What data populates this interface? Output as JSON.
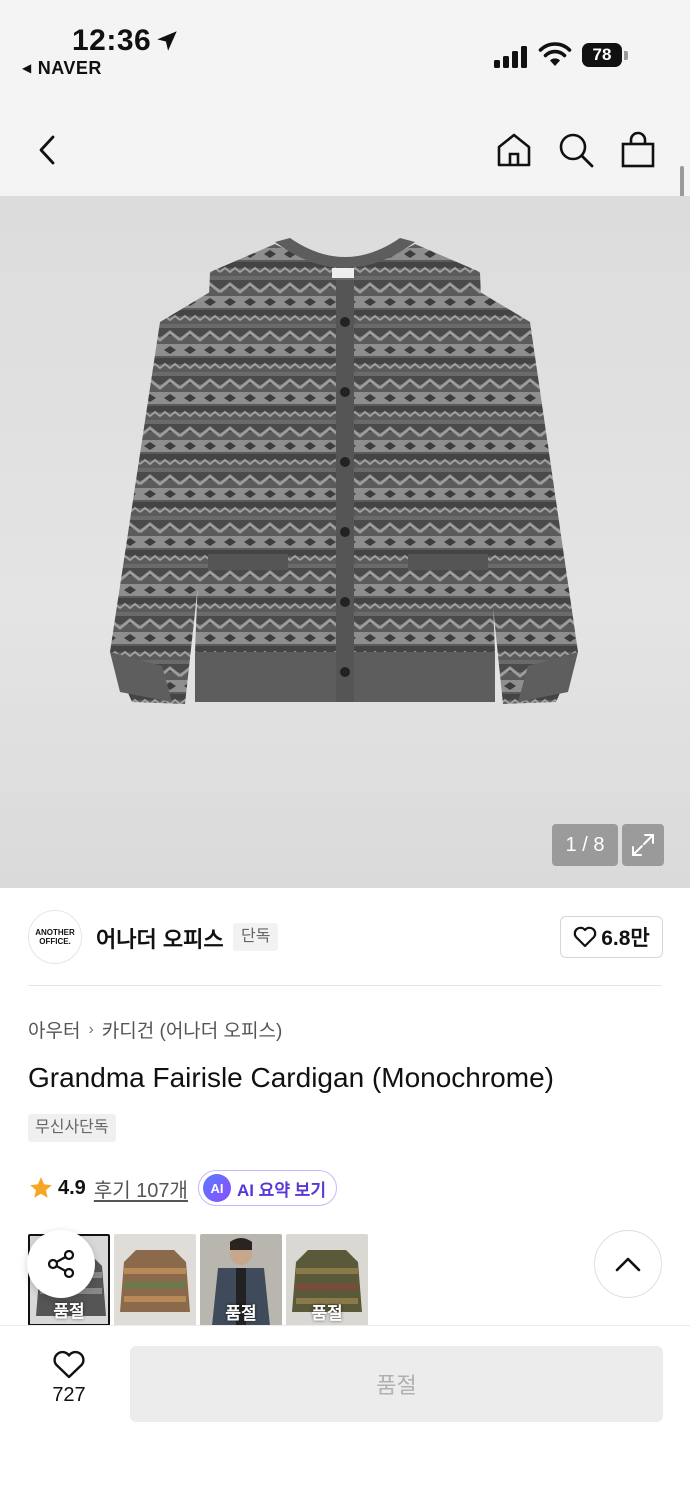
{
  "status_bar": {
    "time": "12:36",
    "back_app": "NAVER",
    "battery": "78"
  },
  "nav": {
    "icons": [
      "back-icon",
      "home-icon",
      "search-icon",
      "shopping-bag-icon"
    ]
  },
  "gallery": {
    "counter": "1 / 8",
    "current_index": 1,
    "total": 8
  },
  "brand": {
    "logo_line1": "ANOTHER",
    "logo_line2": "OFFICE.",
    "name": "어나더 오피스",
    "badge": "단독",
    "likes": "6.8만"
  },
  "product": {
    "breadcrumb": [
      "아우터",
      "카디건 (어나더 오피스)"
    ],
    "title": "Grandma Fairisle Cardigan (Monochrome)",
    "tag": "무신사단독",
    "rating": "4.9",
    "reviews": "후기 107개",
    "ai_badge": "AI",
    "ai_label": "AI 요약 보기"
  },
  "thumbnails": [
    {
      "label": "품절",
      "selected": true
    },
    {
      "label": "",
      "selected": false
    },
    {
      "label": "품절",
      "selected": false
    },
    {
      "label": "품절",
      "selected": false
    }
  ],
  "bottom_bar": {
    "wish_count": "727",
    "cta_label": "품절"
  },
  "colors": {
    "accent_purple": "#5a36d6",
    "star": "#f5a623",
    "soldout_bg": "#ececec"
  }
}
